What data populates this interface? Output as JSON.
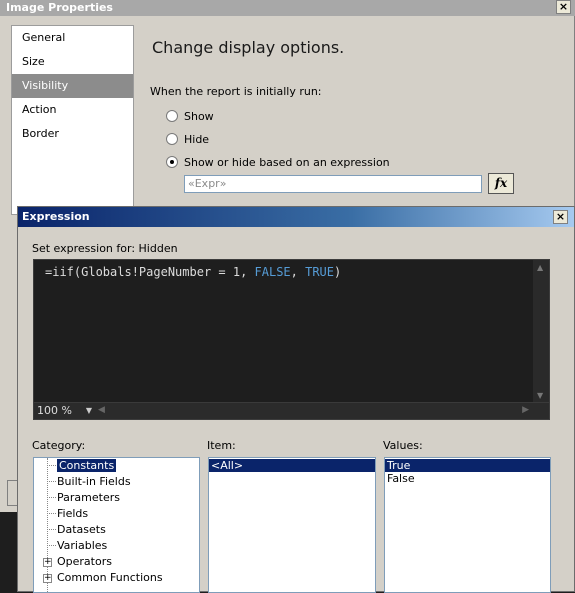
{
  "properties_dialog": {
    "title": "Image Properties",
    "close_symbol": "×",
    "nav": [
      "General",
      "Size",
      "Visibility",
      "Action",
      "Border"
    ],
    "selected_nav": "Visibility",
    "heading": "Change display options.",
    "prompt": "When the report is initially run:",
    "options": [
      {
        "label": "Show",
        "checked": false
      },
      {
        "label": "Hide",
        "checked": false
      },
      {
        "label": "Show or hide based on an expression",
        "checked": true
      }
    ],
    "expression_value": "«Expr»",
    "fx_label": "fx"
  },
  "expression_dialog": {
    "title": "Expression",
    "close_symbol": "×",
    "set_expression_label": "Set expression for: Hidden",
    "code": {
      "prefix": "=iif(Globals!PageNumber = 1, ",
      "kw1": "FALSE",
      "sep": ", ",
      "kw2": "TRUE",
      "suffix": ")"
    },
    "zoom": "100 %",
    "category_label": "Category:",
    "item_label": "Item:",
    "values_label": "Values:",
    "categories": [
      {
        "label": "Constants",
        "selected": true,
        "expandable": false
      },
      {
        "label": "Built-in Fields",
        "selected": false,
        "expandable": false
      },
      {
        "label": "Parameters",
        "selected": false,
        "expandable": false
      },
      {
        "label": "Fields",
        "selected": false,
        "expandable": false
      },
      {
        "label": "Datasets",
        "selected": false,
        "expandable": false
      },
      {
        "label": "Variables",
        "selected": false,
        "expandable": false
      },
      {
        "label": "Operators",
        "selected": false,
        "expandable": true
      },
      {
        "label": "Common Functions",
        "selected": false,
        "expandable": true
      }
    ],
    "items": [
      {
        "label": "<All>",
        "selected": true
      }
    ],
    "values": [
      {
        "label": "True",
        "selected": true
      },
      {
        "label": "False",
        "selected": false
      }
    ]
  },
  "colors": {
    "selection": "#0a246a",
    "editor_bg": "#1e1e1e",
    "keyword": "#569cd6"
  }
}
